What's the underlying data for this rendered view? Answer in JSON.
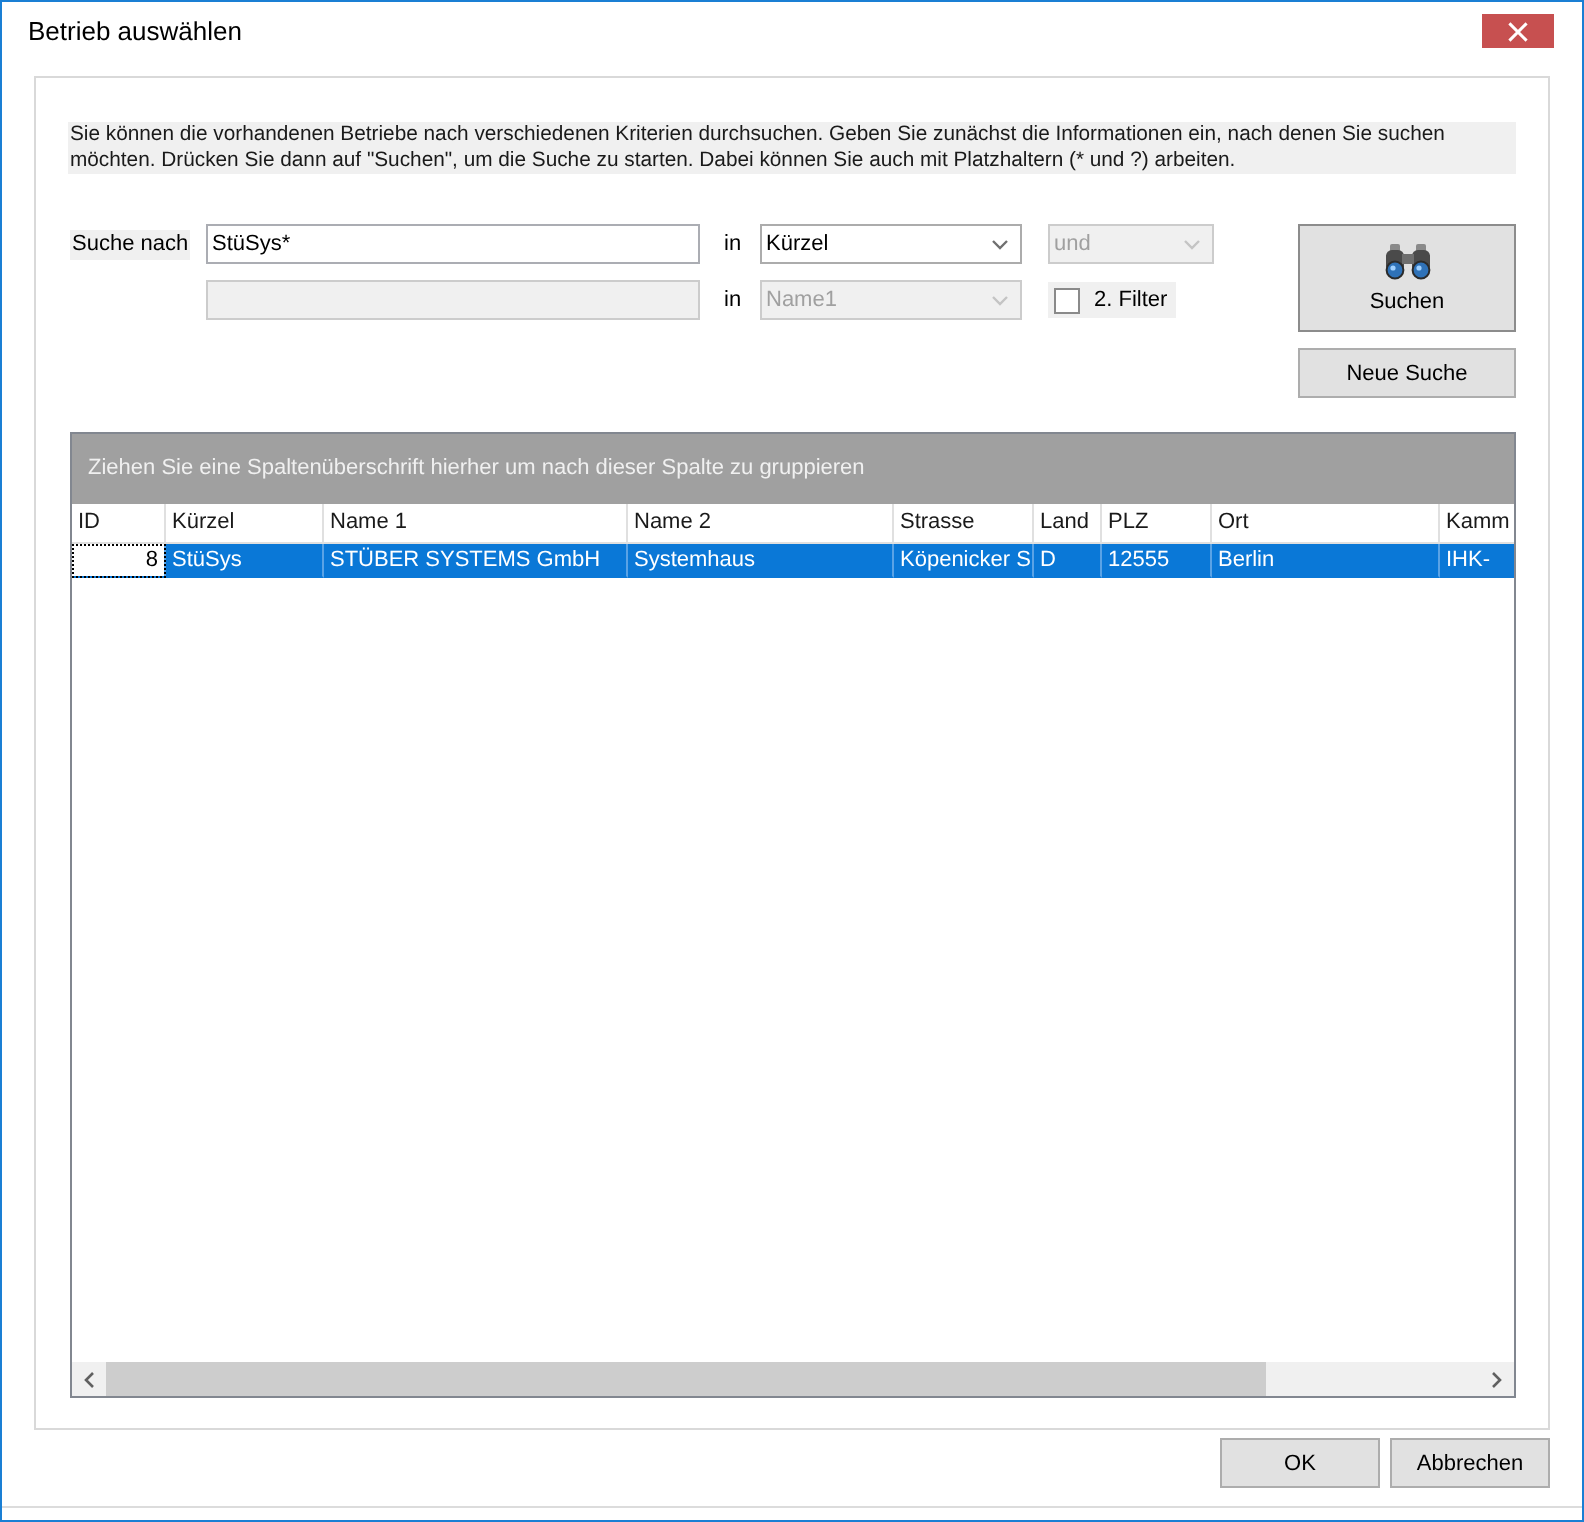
{
  "window": {
    "title": "Betrieb auswählen"
  },
  "intro": "Sie können die vorhandenen Betriebe nach verschiedenen Kriterien durchsuchen. Geben Sie zunächst die Informationen ein, nach denen Sie suchen möchten. Drücken Sie dann auf \"Suchen\", um die Suche zu starten. Dabei können Sie auch mit Platzhaltern (* und ?) arbeiten.",
  "search": {
    "label": "Suche nach",
    "criteria": [
      {
        "value": "StüSys*",
        "disabled": false,
        "in_label": "in",
        "field": {
          "value": "Kürzel",
          "disabled": false
        }
      },
      {
        "disabled": true,
        "in_label": "in",
        "field": {
          "value": "Name1",
          "disabled": true
        }
      }
    ],
    "operator": {
      "value": "und",
      "disabled": true
    },
    "second_filter": {
      "label": "2. Filter",
      "checked": false
    },
    "search_button": "Suchen",
    "new_search_button": "Neue Suche"
  },
  "grid": {
    "group_hint": "Ziehen Sie eine Spaltenüberschrift hierher um nach dieser Spalte zu gruppieren",
    "columns": [
      "ID",
      "Kürzel",
      "Name 1",
      "Name 2",
      "Strasse",
      "Land",
      "PLZ",
      "Ort",
      "Kamm"
    ],
    "rows": [
      {
        "selected": true,
        "cells": [
          {
            "text": "8",
            "focused": true
          },
          {
            "text": "StüSys",
            "focused": false
          },
          {
            "text": "STÜBER SYSTEMS GmbH",
            "focused": false
          },
          {
            "text": "Systemhaus",
            "focused": false
          },
          {
            "text": "Köpenicker S",
            "focused": false
          },
          {
            "text": "D",
            "focused": false
          },
          {
            "text": "12555",
            "focused": false
          },
          {
            "text": "Berlin",
            "focused": false
          },
          {
            "text": "IHK-",
            "focused": false
          }
        ]
      }
    ]
  },
  "buttons": [
    "OK",
    "Abbrechen"
  ]
}
